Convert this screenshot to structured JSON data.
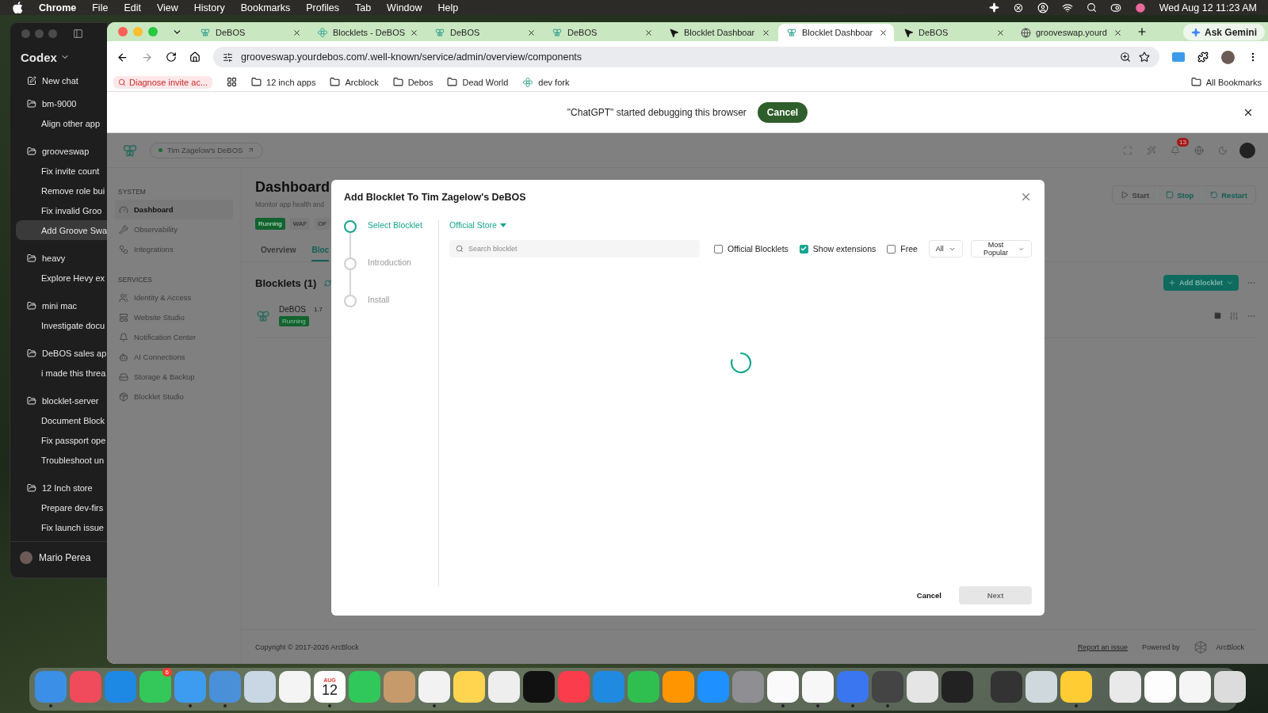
{
  "menu_bar": {
    "app": "Chrome",
    "items": [
      "File",
      "Edit",
      "View",
      "History",
      "Bookmarks",
      "Profiles",
      "Tab",
      "Window",
      "Help"
    ],
    "clock": "Wed Aug 12  11:23 AM"
  },
  "codex": {
    "title": "Codex",
    "new_chat": "New chat",
    "projects": [
      {
        "name": "bm-9000",
        "children": [
          {
            "label": "Align other app",
            "selected": false
          }
        ]
      },
      {
        "name": "grooveswap",
        "children": [
          {
            "label": "Fix invite count",
            "selected": false
          },
          {
            "label": "Remove role bui",
            "selected": false
          },
          {
            "label": "Fix invalid Groo",
            "selected": false
          },
          {
            "label": "Add Groove Swa",
            "selected": true
          }
        ]
      },
      {
        "name": "heavy",
        "children": [
          {
            "label": "Explore Hevy ex",
            "selected": false
          }
        ]
      },
      {
        "name": "mini mac",
        "children": [
          {
            "label": "Investigate docu",
            "selected": false
          }
        ]
      },
      {
        "name": "DeBOS sales ap",
        "children": [
          {
            "label": "i made this threa",
            "selected": false
          }
        ]
      },
      {
        "name": "blocklet-server",
        "children": [
          {
            "label": "Document Block",
            "selected": false
          },
          {
            "label": "Fix passport ope",
            "selected": false
          },
          {
            "label": "Troubleshoot un",
            "selected": false
          }
        ]
      },
      {
        "name": "12 Inch store",
        "children": [
          {
            "label": "Prepare dev-firs",
            "selected": false
          },
          {
            "label": "Fix launch issue",
            "selected": false
          }
        ]
      }
    ],
    "user": "Mario Perea"
  },
  "browser": {
    "tabs": [
      {
        "label": "DeBOS",
        "selected": false
      },
      {
        "label": "Blocklets - DeBOS",
        "selected": false
      },
      {
        "label": "DeBOS",
        "selected": false
      },
      {
        "label": "DeBOS",
        "selected": false
      },
      {
        "label": "Blocklet Dashboar",
        "selected": false
      },
      {
        "label": "Blocklet Dashboar",
        "selected": true
      },
      {
        "label": "DeBOS",
        "selected": false
      },
      {
        "label": "grooveswap.yourd",
        "selected": false
      }
    ],
    "ask_gemini": "Ask Gemini",
    "url": "grooveswap.yourdebos.com/.well-known/service/admin/overview/components",
    "bookmarks": [
      {
        "label": "Diagnose invite ac...",
        "kind": "pinned"
      },
      {
        "label": "12 inch apps",
        "kind": "folder"
      },
      {
        "label": "Arcblock",
        "kind": "folder"
      },
      {
        "label": "Debos",
        "kind": "folder"
      },
      {
        "label": "Dead World",
        "kind": "folder"
      },
      {
        "label": "dev fork",
        "kind": "site"
      }
    ],
    "all_bookmarks": "All Bookmarks",
    "debug": {
      "message": "\"ChatGPT\" started debugging this browser",
      "button": "Cancel"
    }
  },
  "page": {
    "site": "Tim Zagelow's DeBOS",
    "notification_count": "13",
    "sidebar": [
      {
        "heading": "SYSTEM",
        "items": [
          {
            "label": "Dashboard",
            "selected": true
          },
          {
            "label": "Observability",
            "selected": false
          },
          {
            "label": "Integrations",
            "selected": false
          }
        ]
      },
      {
        "heading": "SERVICES",
        "items": [
          {
            "label": "Identity & Access",
            "selected": false
          },
          {
            "label": "Website Studio",
            "selected": false
          },
          {
            "label": "Notification Center",
            "selected": false
          },
          {
            "label": "AI Connections",
            "selected": false
          },
          {
            "label": "Storage & Backup",
            "selected": false
          },
          {
            "label": "Blocklet Studio",
            "selected": false
          }
        ]
      }
    ],
    "title": "Dashboard",
    "subtitle": "Monitor app health and",
    "tags": [
      {
        "label": "Running",
        "kind": "status"
      },
      {
        "label": "WAF",
        "kind": "plain"
      },
      {
        "label": "OF",
        "kind": "plain"
      }
    ],
    "tabs": [
      {
        "label": "Overview",
        "selected": false
      },
      {
        "label": "Bloc",
        "selected": true
      }
    ],
    "actions": [
      {
        "label": "Start",
        "kind": "start",
        "disabled": true
      },
      {
        "label": "Stop",
        "kind": "stop",
        "disabled": false
      },
      {
        "label": "Restart",
        "kind": "restart",
        "disabled": false
      }
    ],
    "section_title": "Blocklets (1)",
    "add_button": "Add Blocklet",
    "blocklet": {
      "name": "DeBOS",
      "version": "1.7",
      "status": "Running"
    },
    "footer": {
      "copyright": "Copyright © 2017-2026  ArcBlock",
      "report": "Report an issue",
      "powered": "Powered by",
      "brand": "ArcBlock"
    }
  },
  "modal": {
    "title": "Add Blocklet To Tim Zagelow's DeBOS",
    "steps": [
      {
        "label": "Select Blocklet",
        "selected": true
      },
      {
        "label": "Introduction",
        "selected": false
      },
      {
        "label": "Install",
        "selected": false
      }
    ],
    "store": "Official Store",
    "search_placeholder": "Search blocklet",
    "filters": [
      {
        "label": "Official Blocklets",
        "checked": false
      },
      {
        "label": "Show extensions",
        "checked": true
      },
      {
        "label": "Free",
        "checked": false
      }
    ],
    "selects": [
      "All",
      "Most Popular"
    ],
    "cancel": "Cancel",
    "next": {
      "label": "Next",
      "disabled": true
    }
  },
  "dock": [
    {
      "apps": [
        {
          "color": "#3b8fe6",
          "running": true
        },
        {
          "color": "#ef4b5c",
          "running": false
        },
        {
          "color": "#1e88e5",
          "running": false
        },
        {
          "color": "#34c759",
          "running": false,
          "badge": "6"
        },
        {
          "color": "#3d9cf0",
          "running": true
        },
        {
          "color": "#4a90d9",
          "running": true
        },
        {
          "color": "#c9d6e3",
          "running": false
        },
        {
          "color": "#f4f4f4",
          "running": false
        },
        {
          "color": "#ffffff",
          "running": true,
          "kind": "calendar",
          "month": "AUG",
          "day": "12"
        },
        {
          "color": "#30c85a",
          "running": false
        },
        {
          "color": "#c79a6b",
          "running": false
        },
        {
          "color": "#f2f2f2",
          "running": true
        },
        {
          "color": "#ffd54f",
          "running": false
        },
        {
          "color": "#eeeeee",
          "running": false
        },
        {
          "color": "#111111",
          "running": false
        },
        {
          "color": "#fa3c4c",
          "running": false
        },
        {
          "color": "#1f8ae0",
          "running": false
        },
        {
          "color": "#2fbf50",
          "running": false
        },
        {
          "color": "#ff9500",
          "running": false
        },
        {
          "color": "#1e90ff",
          "running": false
        },
        {
          "color": "#8e8e93",
          "running": false
        },
        {
          "color": "#fafafa",
          "running": true
        },
        {
          "color": "#f7f7f7",
          "running": true
        },
        {
          "color": "#3a76f0",
          "running": true
        },
        {
          "color": "#444444",
          "running": true
        },
        {
          "color": "#e5e5e5",
          "running": false
        },
        {
          "color": "#222222",
          "running": false
        }
      ]
    },
    {
      "apps": [
        {
          "color": "#333333",
          "running": false
        },
        {
          "color": "#cfd8dc",
          "running": false
        },
        {
          "color": "#ffcc33",
          "running": true
        }
      ]
    },
    {
      "apps": [
        {
          "color": "#e9e9e9",
          "running": false
        },
        {
          "color": "#fdfdfd",
          "running": false
        },
        {
          "color": "#f5f5f5",
          "running": false
        },
        {
          "color": "#dcdcdc",
          "running": false
        }
      ]
    }
  ]
}
